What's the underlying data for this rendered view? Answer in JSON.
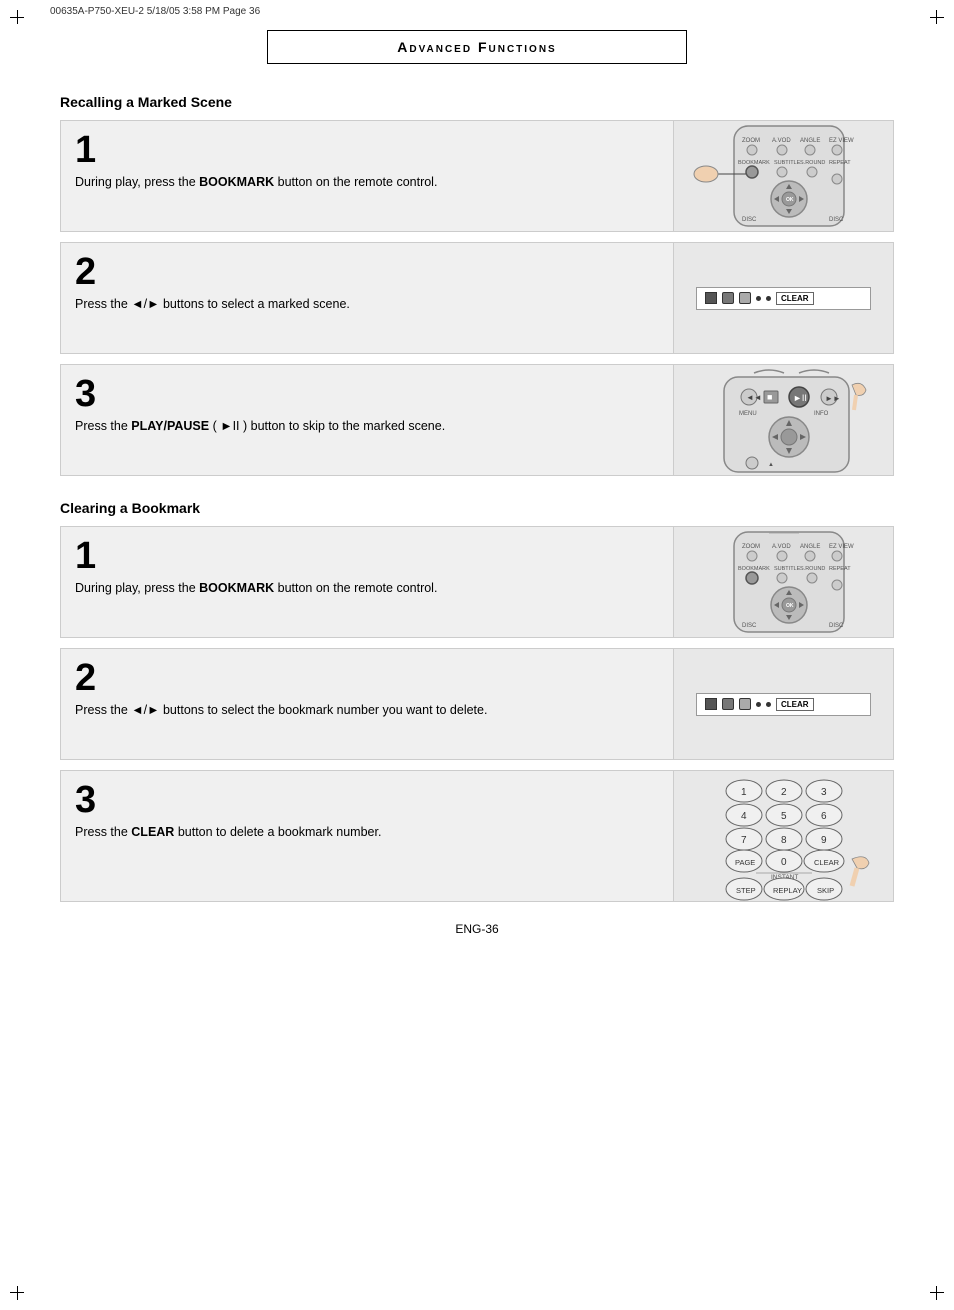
{
  "topbar": {
    "left": "00635A-P750-XEU-2   5/18/05   3:58 PM   Page 36"
  },
  "header": {
    "title": "Advanced Functions"
  },
  "recalling": {
    "heading": "Recalling a Marked Scene",
    "step1": {
      "number": "1",
      "desc_plain": "During play, press the ",
      "desc_bold": "BOOKMARK",
      "desc_end": " button on the remote control."
    },
    "step2": {
      "number": "2",
      "desc": "Press the ◄/► buttons to select a marked scene."
    },
    "step3": {
      "number": "3",
      "desc_plain": "Press the ",
      "desc_bold": "PLAY/PAUSE",
      "desc_mid": " ( ►II ) button to skip to the marked scene."
    }
  },
  "clearing": {
    "heading": "Clearing a Bookmark",
    "step1": {
      "number": "1",
      "desc_plain": "During play, press the ",
      "desc_bold": "BOOKMARK",
      "desc_end": " button on the remote control."
    },
    "step2": {
      "number": "2",
      "desc": "Press the ◄/► buttons to select the bookmark number you want to delete."
    },
    "step3": {
      "number": "3",
      "desc_plain": "Press the ",
      "desc_bold": "CLEAR",
      "desc_end": " button to delete a bookmark number."
    }
  },
  "footer": {
    "page": "ENG-36"
  },
  "icons": {
    "clear_label": "CLEAR"
  }
}
